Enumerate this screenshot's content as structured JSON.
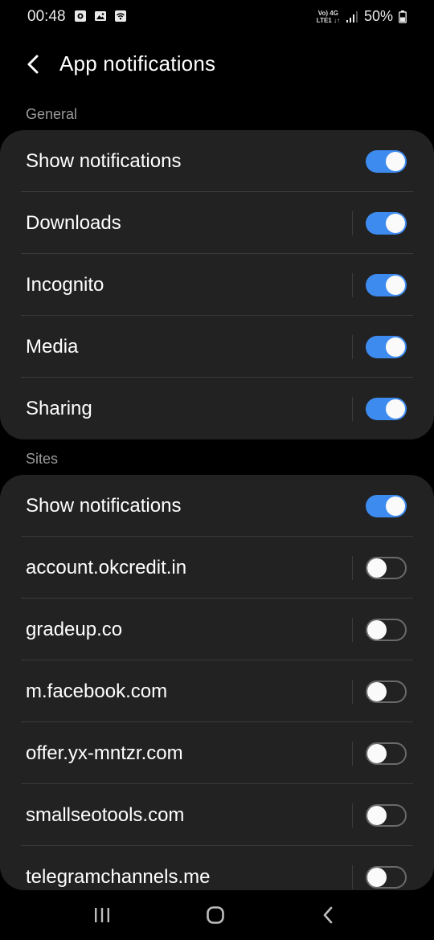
{
  "status_bar": {
    "time": "00:48",
    "net_top": "Vo) 4G",
    "net_bottom": "LTE1 ↓↑",
    "battery": "50%"
  },
  "header": {
    "title": "App notifications"
  },
  "general": {
    "header": "General",
    "rows": [
      {
        "label": "Show notifications",
        "on": true
      },
      {
        "label": "Downloads",
        "on": true
      },
      {
        "label": "Incognito",
        "on": true
      },
      {
        "label": "Media",
        "on": true
      },
      {
        "label": "Sharing",
        "on": true
      }
    ]
  },
  "sites": {
    "header": "Sites",
    "rows": [
      {
        "label": "Show notifications",
        "on": true
      },
      {
        "label": "account.okcredit.in",
        "on": false
      },
      {
        "label": "gradeup.co",
        "on": false
      },
      {
        "label": "m.facebook.com",
        "on": false
      },
      {
        "label": "offer.yx-mntzr.com",
        "on": false
      },
      {
        "label": "smallseotools.com",
        "on": false
      },
      {
        "label": "telegramchannels.me",
        "on": false
      }
    ]
  },
  "colors": {
    "accent": "#3e8bf0",
    "card": "#222222",
    "background": "#000000"
  }
}
